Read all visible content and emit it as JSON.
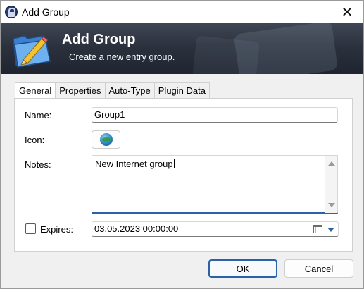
{
  "window": {
    "title": "Add Group",
    "close_glyph": "✕"
  },
  "banner": {
    "title": "Add Group",
    "subtitle": "Create a new entry group."
  },
  "tabs": [
    {
      "label": "General",
      "active": true
    },
    {
      "label": "Properties",
      "active": false
    },
    {
      "label": "Auto-Type",
      "active": false
    },
    {
      "label": "Plugin Data",
      "active": false
    }
  ],
  "form": {
    "name_label": "Name:",
    "name_value": "Group1",
    "icon_label": "Icon:",
    "icon_name": "globe-icon",
    "notes_label": "Notes:",
    "notes_value": "New Internet group",
    "expires_label": "Expires:",
    "expires_checked": false,
    "expires_value": "03.05.2023 00:00:00"
  },
  "buttons": {
    "ok": "OK",
    "cancel": "Cancel"
  },
  "colors": {
    "accent": "#2a62a8",
    "banner_top": "#3f4654",
    "banner_bottom": "#1f2430"
  }
}
